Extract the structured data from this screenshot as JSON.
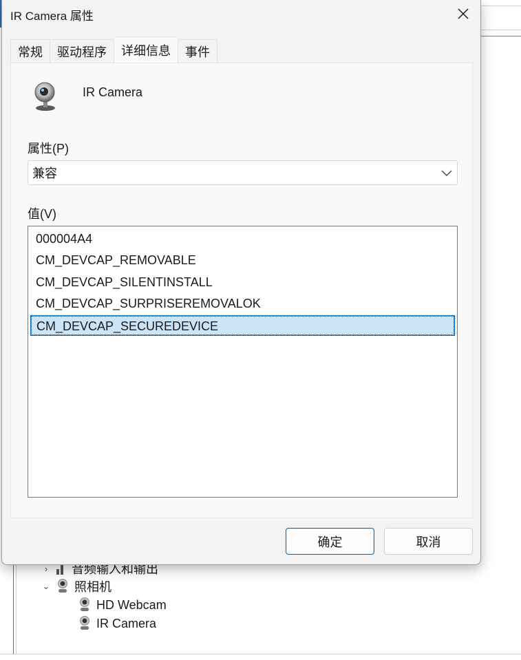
{
  "dialog": {
    "title": "IR Camera 属性",
    "tabs": [
      {
        "label": "常规",
        "active": false
      },
      {
        "label": "驱动程序",
        "active": false
      },
      {
        "label": "详细信息",
        "active": true
      },
      {
        "label": "事件",
        "active": false
      }
    ],
    "device_name": "IR Camera",
    "device_icon": "webcam-icon",
    "property_label": "属性(P)",
    "property_selected": "兼容",
    "value_label": "值(V)",
    "values": [
      {
        "text": "000004A4",
        "selected": false
      },
      {
        "text": "CM_DEVCAP_REMOVABLE",
        "selected": false
      },
      {
        "text": "CM_DEVCAP_SILENTINSTALL",
        "selected": false
      },
      {
        "text": "CM_DEVCAP_SURPRISEREMOVALOK",
        "selected": false
      },
      {
        "text": "CM_DEVCAP_SECUREDEVICE",
        "selected": true
      }
    ],
    "ok_label": "确定",
    "cancel_label": "取消"
  },
  "background_tree": {
    "items": [
      {
        "label": "音频输入和输出",
        "expanded": false,
        "icon": "audio-icon"
      },
      {
        "label": "照相机",
        "expanded": true,
        "icon": "camera-icon"
      },
      {
        "label": "HD Webcam",
        "icon": "camera-icon"
      },
      {
        "label": "IR Camera",
        "icon": "camera-icon"
      }
    ]
  },
  "colors": {
    "selection_bg": "#cce4f7",
    "selection_border": "#0078d4",
    "default_button_border": "#0067c0"
  }
}
